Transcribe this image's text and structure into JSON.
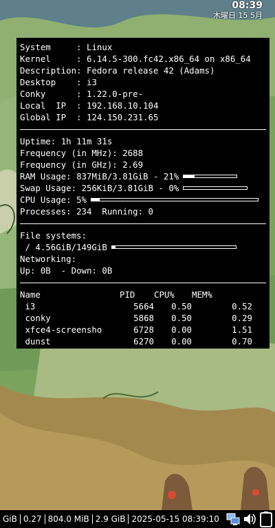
{
  "top_clock": {
    "time": "08:39",
    "date": "木曜日 15 5月"
  },
  "system_info": [
    {
      "key": "System     : ",
      "value": "Linux"
    },
    {
      "key": "Kernel     : ",
      "value": "6.14.5-300.fc42.x86_64 on x86_64"
    },
    {
      "key": "Description: ",
      "value": "Fedora release 42 (Adams)"
    },
    {
      "key": "Desktop    : ",
      "value": "i3"
    },
    {
      "key": "Conky      : ",
      "value": "1.22.0-pre-"
    },
    {
      "key": "Local  IP  : ",
      "value": "192.168.10.104"
    },
    {
      "key": "Global IP  : ",
      "value": "124.150.231.65"
    }
  ],
  "stats": {
    "uptime_label": "Uptime: ",
    "uptime": "1h 11m 31s",
    "freq_mhz_label": "Frequency (in MHz): ",
    "freq_mhz": "2688",
    "freq_ghz_label": "Frequency (in GHz): ",
    "freq_ghz": "2.69",
    "ram_label": "RAM Usage: ",
    "ram": "837MiB/3.81GiB - 21%",
    "ram_fraction": 0.21,
    "swap_label": "Swap Usage: ",
    "swap": "256KiB/3.81GiB - 0%",
    "swap_fraction": 0.0,
    "cpu_label": "CPU Usage: ",
    "cpu": "5%",
    "cpu_fraction": 0.05,
    "processes_label": "Processes: ",
    "processes": "234",
    "running_label": "  Running: ",
    "running": "0"
  },
  "filesystems": {
    "label": "File systems:",
    "root": " / 4.56GiB/149GiB",
    "root_fraction": 0.03,
    "net_label": "Networking:",
    "up_label": "Up: ",
    "up": "0B",
    "down_label": "  - Down: ",
    "down": "0B"
  },
  "processes": {
    "headers": [
      "Name",
      "PID",
      "CPU%",
      "MEM%"
    ],
    "rows": [
      [
        " i3",
        "5664",
        "0.50",
        "0.52"
      ],
      [
        " conky",
        "5868",
        "0.50",
        "0.29"
      ],
      [
        " xfce4-screensho",
        "6728",
        "0.00",
        "1.51"
      ],
      [
        " dunst",
        "6270",
        "0.00",
        "0.70"
      ]
    ]
  },
  "statusbar": {
    "segments": [
      "GiB",
      "0.27",
      "804.0 MiB",
      "2.9 GiB",
      "2025-05-15 08:39:10"
    ]
  },
  "colors": {
    "panel_bg": "#000000",
    "text": "#ffffff",
    "statusbar_bg": "#000000"
  },
  "tray_icons": [
    "network-icon",
    "volume-icon",
    "battery-icon"
  ]
}
